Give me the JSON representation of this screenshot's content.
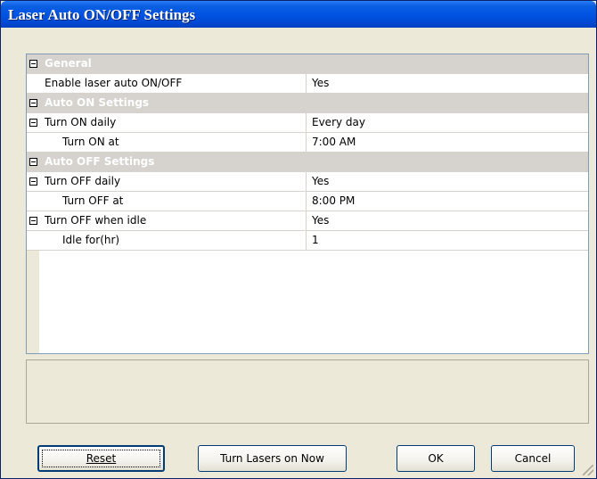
{
  "window": {
    "title": "Laser Auto ON/OFF Settings"
  },
  "grid": {
    "general": {
      "category": "General",
      "enable_label": "Enable laser auto ON/OFF",
      "enable_value": "Yes"
    },
    "auto_on": {
      "category": "Auto ON Settings",
      "daily_label": "Turn ON daily",
      "daily_value": "Every day",
      "at_label": "Turn ON at",
      "at_value": "7:00 AM"
    },
    "auto_off": {
      "category": "Auto OFF Settings",
      "daily_label": "Turn OFF daily",
      "daily_value": "Yes",
      "at_label": "Turn OFF at",
      "at_value": "8:00 PM",
      "idle_label": "Turn OFF when idle",
      "idle_value": "Yes",
      "idle_for_label": "Idle for(hr)",
      "idle_for_value": "1"
    }
  },
  "buttons": {
    "reset": "Reset",
    "turn_lasers_on": "Turn Lasers on Now",
    "ok": "OK",
    "cancel": "Cancel"
  },
  "colors": {
    "titlebar": "#0054e3",
    "window_bg": "#ece9d8",
    "category_bg": "#d6d3ce",
    "button_border": "#003c74"
  }
}
